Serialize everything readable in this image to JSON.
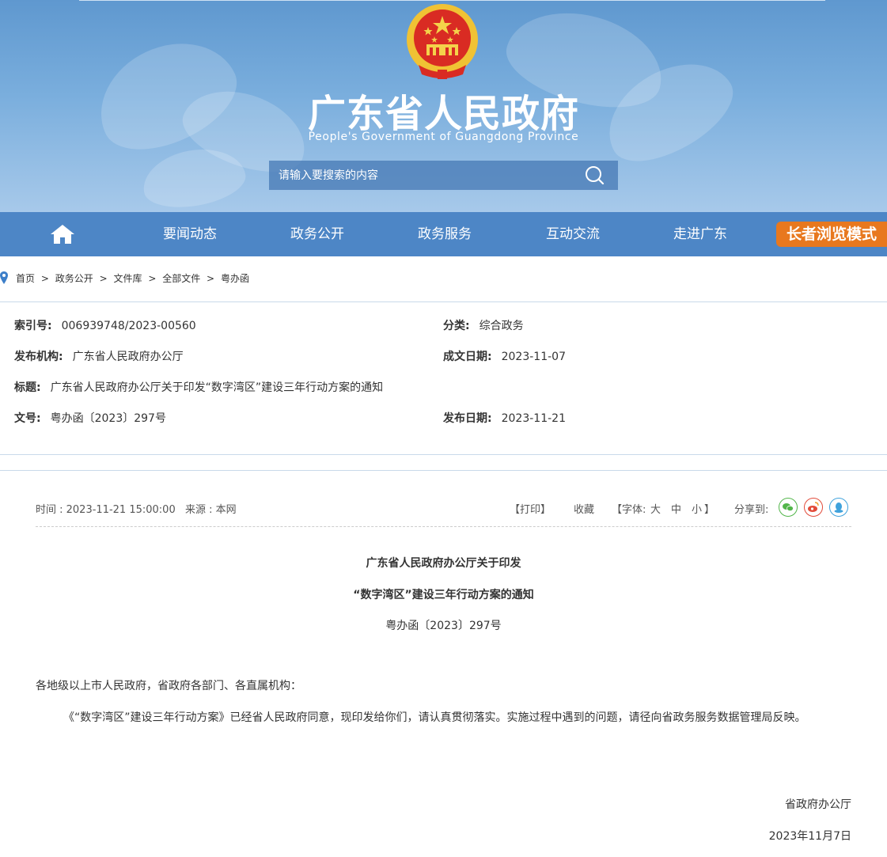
{
  "header": {
    "title_cn": "广东省人民政府",
    "title_en": "People's Government of Guangdong Province",
    "search_placeholder": "请输入要搜索的内容"
  },
  "nav": {
    "items": [
      "要闻动态",
      "政务公开",
      "政务服务",
      "互动交流",
      "走进广东"
    ],
    "elder_mode": "长者浏览模式"
  },
  "breadcrumb": [
    "首页",
    ">",
    "政务公开",
    ">",
    "文件库",
    ">",
    "全部文件",
    ">",
    "粤办函"
  ],
  "meta": {
    "index_label": "索引号:",
    "index_value": "006939748/2023-00560",
    "category_label": "分类:",
    "category_value": "综合政务",
    "publisher_label": "发布机构:",
    "publisher_value": "广东省人民政府办公厅",
    "created_label": "成文日期:",
    "created_value": "2023-11-07",
    "title_label": "标题:",
    "title_value": "广东省人民政府办公厅关于印发“数字湾区”建设三年行动方案的通知",
    "docno_label": "文号:",
    "docno_value": "粤办函〔2023〕297号",
    "published_label": "发布日期:",
    "published_value": "2023-11-21"
  },
  "article_bar": {
    "time": "时间 : 2023-11-21 15:00:00",
    "source": "来源 : 本网",
    "print": "【打印】",
    "favorite": "收藏",
    "font_open": "【字体:",
    "font_large": "大",
    "font_medium": "中",
    "font_small": "小",
    "font_close": "】",
    "share_label": "分享到:"
  },
  "article": {
    "title_line1": "广东省人民政府办公厅关于印发",
    "title_line2": "“数字湾区”建设三年行动方案的通知",
    "doc_number": "粤办函〔2023〕297号",
    "salutation": "各地级以上市人民政府，省政府各部门、各直属机构：",
    "body": "《“数字湾区”建设三年行动方案》已经省人民政府同意，现印发给你们，请认真贯彻落实。实施过程中遇到的问题，请径向省政务服务数据管理局反映。",
    "signature": "省政府办公厅",
    "date": "2023年11月7日"
  },
  "colors": {
    "nav_blue": "#4d86c6",
    "elder_orange": "#e8781e",
    "wechat_green": "#52b64a",
    "weibo_red": "#e24b3a",
    "qq_blue": "#3fa2dc"
  }
}
